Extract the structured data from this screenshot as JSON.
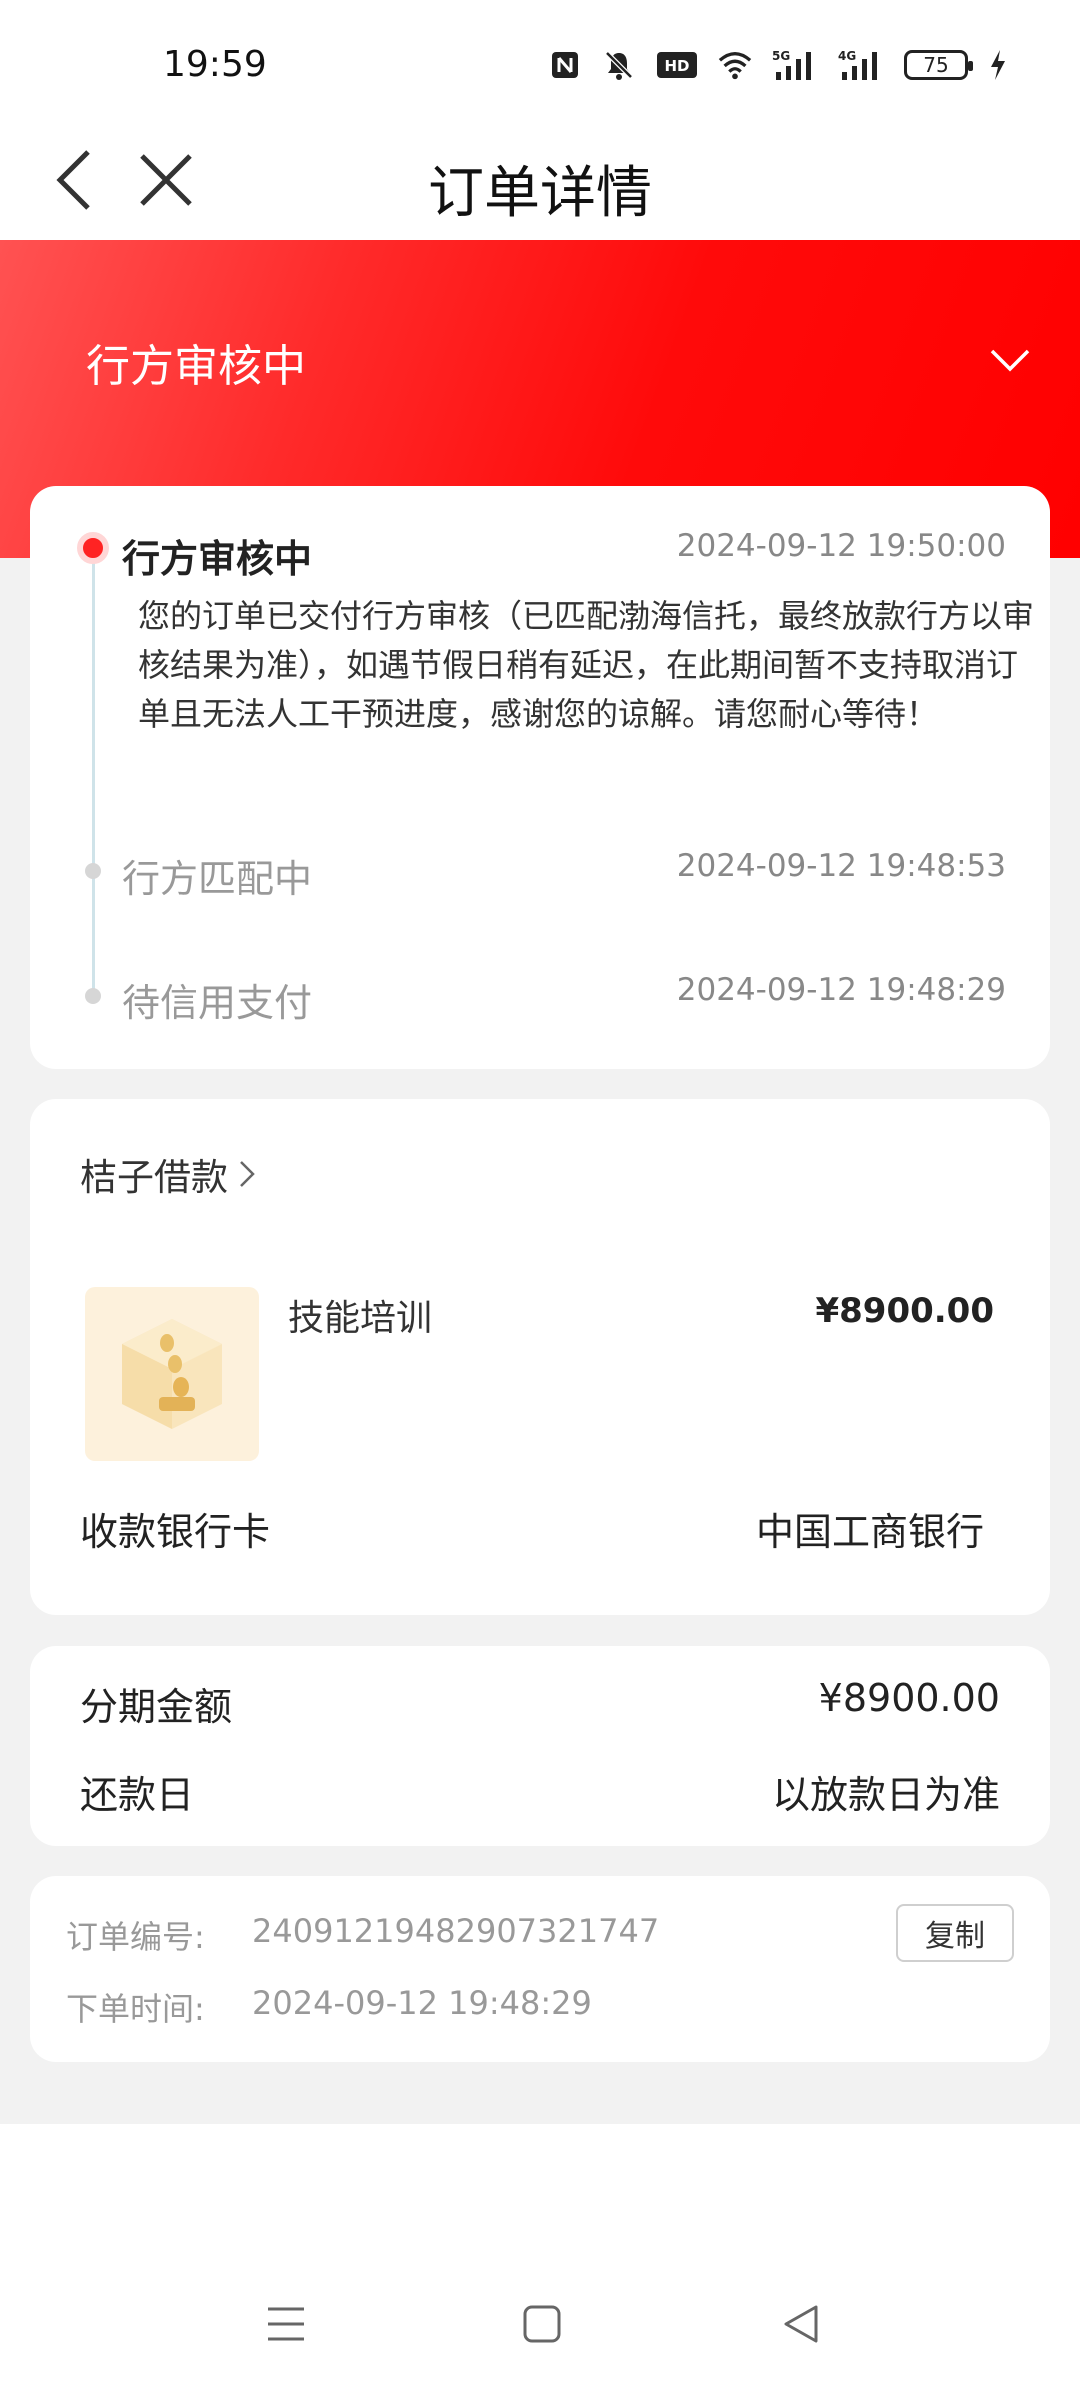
{
  "status_bar": {
    "time": "19:59",
    "battery": "75",
    "icons": [
      "nfc-icon",
      "mute-icon",
      "hd-icon",
      "wifi-icon",
      "5g-signal-icon",
      "4g-signal-icon",
      "battery-icon",
      "charging-icon"
    ],
    "network_5g": "5G",
    "network_4g": "4G",
    "hd": "HD"
  },
  "nav": {
    "title": "订单详情",
    "back_icon": "chevron-left-icon",
    "close_icon": "close-icon"
  },
  "hero": {
    "status_title": "行方审核中",
    "expand_icon": "chevron-down-icon",
    "colors": {
      "start": "#ff5252",
      "end": "#ff0000"
    }
  },
  "timeline": [
    {
      "title": "行方审核中",
      "time": "2024-09-12 19:50:00",
      "active": true,
      "description": "您的订单已交付行方审核（已匹配渤海信托，最终放款行方以审核结果为准），如遇节假日稍有延迟，在此期间暂不支持取消订单且无法人工干预进度，感谢您的谅解。请您耐心等待！"
    },
    {
      "title": "行方匹配中",
      "time": "2024-09-12 19:48:53",
      "active": false
    },
    {
      "title": "待信用支付",
      "time": "2024-09-12 19:48:29",
      "active": false
    }
  ],
  "product": {
    "merchant": "桔子借款",
    "merchant_icon": "chevron-right-icon",
    "name": "技能培训",
    "price": "¥8900.00",
    "bank_label": "收款银行卡",
    "bank_value": "中国工商银行"
  },
  "installment": {
    "amount_label": "分期金额",
    "amount_value": "¥8900.00",
    "repay_label": "还款日",
    "repay_value": "以放款日为准"
  },
  "order_info": {
    "number_label": "订单编号:",
    "number_value": "24091219482907321747",
    "time_label": "下单时间:",
    "time_value": "2024-09-12 19:48:29",
    "copy_label": "复制"
  },
  "system_nav": {
    "icons": [
      "menu-icon",
      "home-square-icon",
      "back-triangle-icon"
    ]
  }
}
